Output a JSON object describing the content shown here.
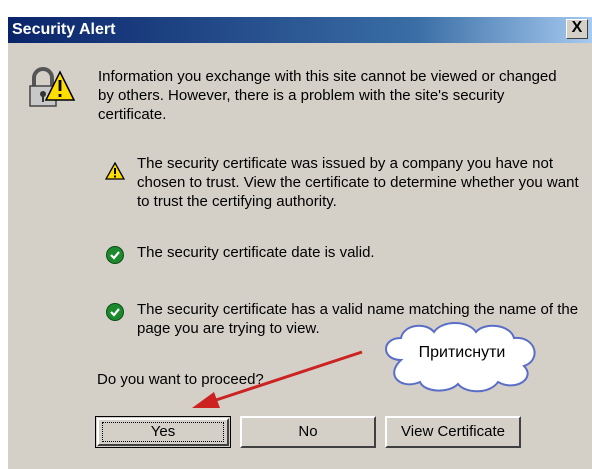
{
  "dialog": {
    "title": "Security Alert",
    "close_label": "X",
    "intro": "Information you exchange with this site cannot be viewed or changed by others. However, there is a problem with the site's security certificate.",
    "items": [
      {
        "icon": "warning-icon",
        "text": "The security certificate was issued by a company you have not chosen to trust. View the certificate to determine whether you want to trust the certifying authority."
      },
      {
        "icon": "check-icon",
        "text": "The security certificate date is valid."
      },
      {
        "icon": "check-icon",
        "text": "The security certificate has a valid name matching the name of the page you are trying to view."
      }
    ],
    "question": "Do you want to proceed?",
    "buttons": {
      "yes": "Yes",
      "no": "No",
      "view": "View Certificate"
    }
  },
  "annotation": {
    "callout": "Притиснути"
  },
  "colors": {
    "titlebar": "#0a246a",
    "dialog_bg": "#d4d0c8",
    "arrow": "#cc2222",
    "callout_fill": "#ffffff",
    "callout_stroke": "#5a6ec8",
    "check_icon": "#1c8a2c",
    "warning_icon": "#ffdd00"
  }
}
